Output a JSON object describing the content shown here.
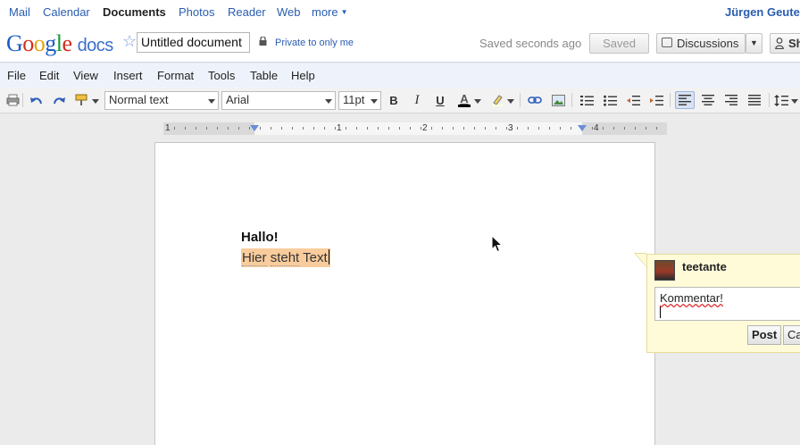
{
  "services": {
    "items": [
      {
        "label": "Mail"
      },
      {
        "label": "Calendar"
      },
      {
        "label": "Documents"
      },
      {
        "label": "Photos"
      },
      {
        "label": "Reader"
      },
      {
        "label": "Web"
      },
      {
        "label": "more"
      }
    ],
    "user": "Jürgen Geute"
  },
  "header": {
    "logo": {
      "google": [
        "G",
        "o",
        "o",
        "g",
        "l",
        "e"
      ],
      "product": "docs"
    },
    "document_title": "Untitled document",
    "privacy": "Private to only me",
    "save_status": "Saved seconds ago",
    "saved_button": "Saved",
    "discussions_button": "Discussions",
    "share_button": "Sh"
  },
  "menu": {
    "items": [
      {
        "label": "File"
      },
      {
        "label": "Edit"
      },
      {
        "label": "View"
      },
      {
        "label": "Insert"
      },
      {
        "label": "Format"
      },
      {
        "label": "Tools"
      },
      {
        "label": "Table"
      },
      {
        "label": "Help"
      }
    ]
  },
  "toolbar": {
    "style_select": "Normal text",
    "font_select": "Arial",
    "size_select": "11pt",
    "bold": "B",
    "italic": "I",
    "underline": "U",
    "text_color_letter": "A",
    "text_color": "#000000",
    "alignment": "left"
  },
  "ruler": {
    "labels": [
      "1",
      "1",
      "2",
      "3",
      "4"
    ]
  },
  "document": {
    "heading": "Hallo!",
    "highlight_color": "#f9cc9d",
    "words": [
      "Hier",
      "steht",
      "Text"
    ]
  },
  "comment": {
    "author": "teetante",
    "text": "Kommentar!",
    "post_button": "Post",
    "cancel_button": "Ca",
    "background": "#fffbd8"
  },
  "colors": {
    "link": "#2a5db0",
    "menubar": "#eef3fb"
  }
}
